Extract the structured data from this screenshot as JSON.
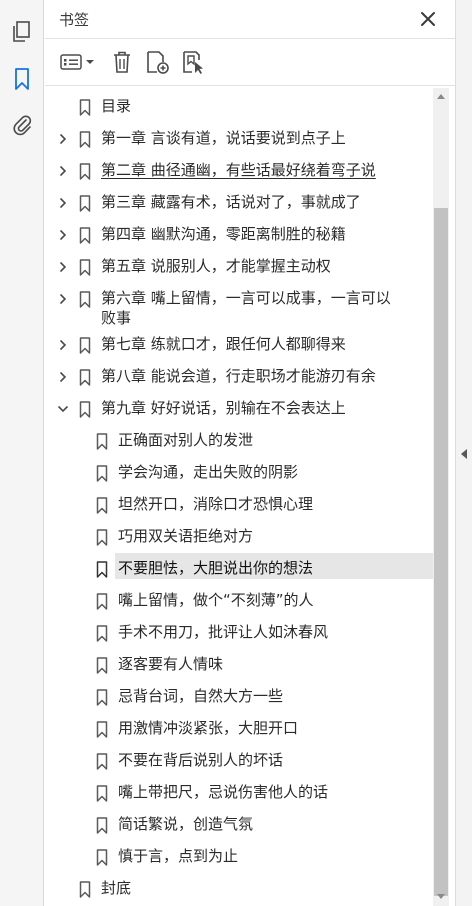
{
  "panel": {
    "title": "书签"
  },
  "icons": {
    "rail": [
      "pages-icon",
      "bookmark-icon",
      "attachment-icon"
    ],
    "toolbar": [
      "options-menu-icon",
      "delete-icon",
      "new-bookmark-icon",
      "bookmark-from-selection-icon"
    ],
    "close": "close-icon"
  },
  "colors": {
    "accent": "#1473e6",
    "selected_bg": "#e6e6e6",
    "icon": "#4b4b4b"
  },
  "bookmarks": [
    {
      "label": "目录",
      "level": 0,
      "expander": "none"
    },
    {
      "label": "第一章 言谈有道，说话要说到点子上",
      "level": 0,
      "expander": "collapsed"
    },
    {
      "label": "第二章 曲径通幽，有些话最好绕着弯子说",
      "level": 0,
      "expander": "collapsed"
    },
    {
      "label": "第三章 藏露有术，话说对了，事就成了",
      "level": 0,
      "expander": "collapsed"
    },
    {
      "label": "第四章 幽默沟通，零距离制胜的秘籍",
      "level": 0,
      "expander": "collapsed"
    },
    {
      "label": "第五章 说服别人，才能掌握主动权",
      "level": 0,
      "expander": "collapsed"
    },
    {
      "label": "第六章 嘴上留情，一言可以成事，一言可以败事",
      "level": 0,
      "expander": "collapsed"
    },
    {
      "label": "第七章 练就口才，跟任何人都聊得来",
      "level": 0,
      "expander": "collapsed"
    },
    {
      "label": "第八章 能说会道，行走职场才能游刃有余",
      "level": 0,
      "expander": "collapsed"
    },
    {
      "label": "第九章 好好说话，别输在不会表达上",
      "level": 0,
      "expander": "expanded"
    },
    {
      "label": "正确面对别人的发泄",
      "level": 1,
      "expander": "none"
    },
    {
      "label": "学会沟通，走出失败的阴影",
      "level": 1,
      "expander": "none"
    },
    {
      "label": "坦然开口，消除口才恐惧心理",
      "level": 1,
      "expander": "none"
    },
    {
      "label": "巧用双关语拒绝对方",
      "level": 1,
      "expander": "none"
    },
    {
      "label": "不要胆怯，大胆说出你的想法",
      "level": 1,
      "expander": "none",
      "selected": true
    },
    {
      "label": "嘴上留情，做个“不刻薄”的人",
      "level": 1,
      "expander": "none"
    },
    {
      "label": "手术不用刀，批评让人如沐春风",
      "level": 1,
      "expander": "none"
    },
    {
      "label": "逐客要有人情味",
      "level": 1,
      "expander": "none"
    },
    {
      "label": "忌背台词，自然大方一些",
      "level": 1,
      "expander": "none"
    },
    {
      "label": "用激情冲淡紧张，大胆开口",
      "level": 1,
      "expander": "none"
    },
    {
      "label": "不要在背后说别人的坏话",
      "level": 1,
      "expander": "none"
    },
    {
      "label": "嘴上带把尺，忌说伤害他人的话",
      "level": 1,
      "expander": "none"
    },
    {
      "label": "简话繁说，创造气氛",
      "level": 1,
      "expander": "none"
    },
    {
      "label": "慎于言，点到为止",
      "level": 1,
      "expander": "none"
    },
    {
      "label": "封底",
      "level": 0,
      "expander": "none"
    }
  ]
}
